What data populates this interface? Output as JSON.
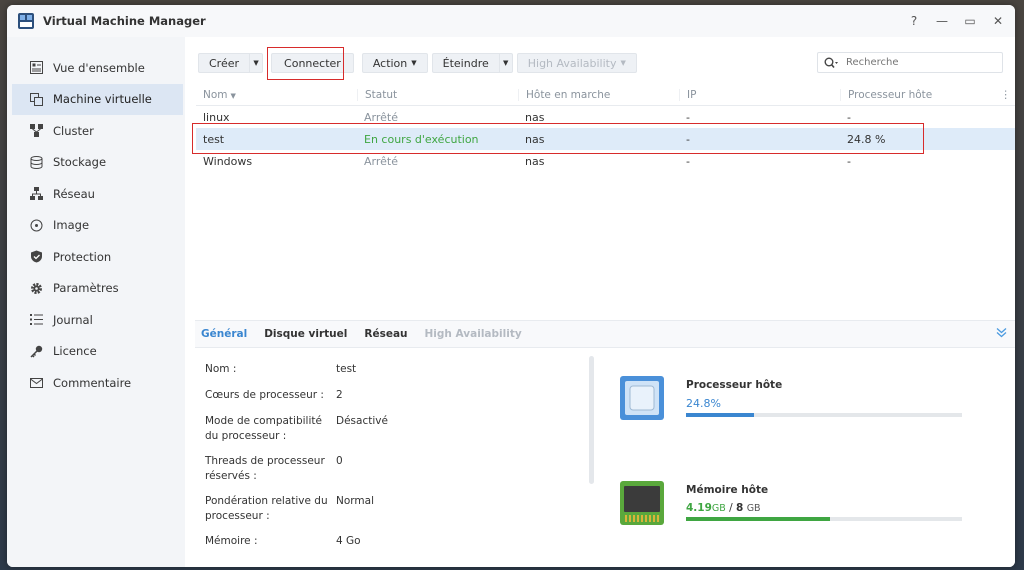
{
  "app": {
    "title": "Virtual Machine Manager",
    "controls": [
      "?",
      "—",
      "▭",
      "✕"
    ]
  },
  "sidebar": {
    "items": [
      {
        "label": "Vue d'ensemble",
        "icon": "overview-icon"
      },
      {
        "label": "Machine virtuelle",
        "icon": "vm-icon",
        "active": true
      },
      {
        "label": "Cluster",
        "icon": "cluster-icon"
      },
      {
        "label": "Stockage",
        "icon": "storage-icon"
      },
      {
        "label": "Réseau",
        "icon": "network-icon"
      },
      {
        "label": "Image",
        "icon": "image-icon"
      },
      {
        "label": "Protection",
        "icon": "shield-icon"
      },
      {
        "label": "Paramètres",
        "icon": "gear-icon"
      },
      {
        "label": "Journal",
        "icon": "log-icon"
      },
      {
        "label": "Licence",
        "icon": "key-icon"
      },
      {
        "label": "Commentaire",
        "icon": "mail-icon"
      }
    ]
  },
  "toolbar": {
    "create": "Créer",
    "connect": "Connecter",
    "action": "Action",
    "shutdown": "Éteindre",
    "ha": "High Availability",
    "search_placeholder": "Recherche"
  },
  "grid": {
    "headers": [
      "Nom",
      "Statut",
      "Hôte en marche",
      "IP",
      "Processeur hôte"
    ],
    "rows": [
      {
        "name": "linux",
        "status": "Arrêté",
        "host": "nas",
        "ip": "-",
        "cpu": "-"
      },
      {
        "name": "test",
        "status": "En cours d'exécution",
        "host": "nas",
        "ip": "-",
        "cpu": "24.8 %"
      },
      {
        "name": "Windows",
        "status": "Arrêté",
        "host": "nas",
        "ip": "-",
        "cpu": "-"
      }
    ]
  },
  "details": {
    "tabs": [
      "Général",
      "Disque virtuel",
      "Réseau",
      "High Availability"
    ],
    "props": [
      {
        "label": "Nom :",
        "value": "test"
      },
      {
        "label": "Cœurs de processeur :",
        "value": "2"
      },
      {
        "label": "Mode de compatibilité du processeur :",
        "value": "Désactivé"
      },
      {
        "label": "Threads de processeur réservés :",
        "value": "0"
      },
      {
        "label": "Pondération relative du processeur :",
        "value": "Normal"
      },
      {
        "label": "Mémoire :",
        "value": "4 Go"
      }
    ],
    "cpu": {
      "title": "Processeur hôte",
      "value": "24.8",
      "unit": "%",
      "fraction": 0.248,
      "color": "#3a86d0"
    },
    "memory": {
      "title": "Mémoire hôte",
      "used": "4.19",
      "used_unit": "GB",
      "sep": " / ",
      "total": "8",
      "total_unit": "GB",
      "fraction": 0.52,
      "color": "#3fa642"
    }
  }
}
